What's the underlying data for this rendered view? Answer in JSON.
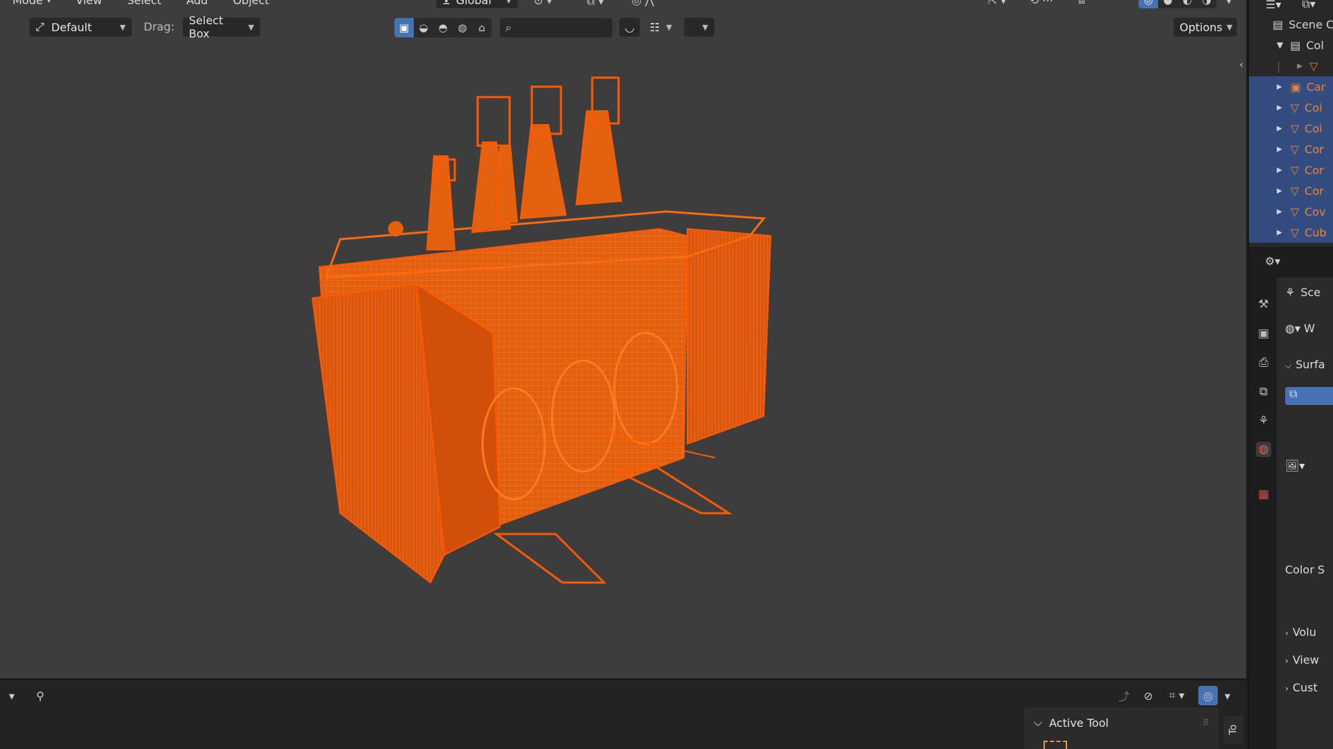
{
  "menu": {
    "mode": "Mode",
    "items": [
      "View",
      "Select",
      "Add",
      "Object"
    ]
  },
  "header": {
    "transform_orientation": "Global"
  },
  "toolbar": {
    "orientation_value": "Default",
    "drag_label": "Drag:",
    "drag_value": "Select Box",
    "search_placeholder": "",
    "options_label": "Options"
  },
  "outliner": {
    "scene_collection": "Scene C",
    "collection": "Col",
    "rows": [
      "Car",
      "Coi",
      "Coi",
      "Cor",
      "Cor",
      "Cor",
      "Cov",
      "Cub"
    ]
  },
  "properties": {
    "scene": "Sce",
    "world": "W",
    "surface": "Surfa",
    "color_space": "Color S",
    "volume": "Volu",
    "viewport": "View",
    "custom": "Cust"
  },
  "bottom": {
    "active_tool": "Active Tool",
    "tool_tab": "To"
  },
  "colors": {
    "viewport_bg": "#3d3d3d",
    "wire": "#ff5a00",
    "accent": "#4772b3"
  }
}
